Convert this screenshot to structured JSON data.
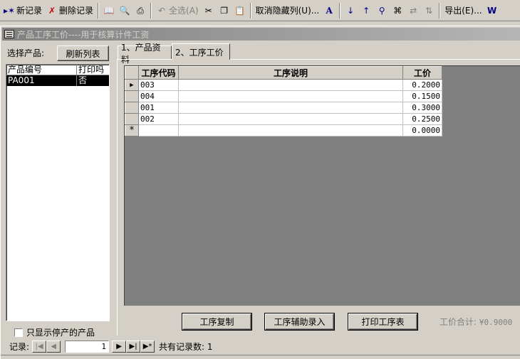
{
  "toolbar": {
    "new_record": "新记录",
    "delete_record": "删除记录",
    "undo": "全选(A)",
    "unhide_columns": "取消隐藏列(U)...",
    "export": "导出(E)..."
  },
  "window": {
    "title": "产品工序工价----用于核算计件工资"
  },
  "left": {
    "select_label": "选择产品:",
    "refresh_button": "刷新列表",
    "list_headers": [
      "产品编号",
      "打印吗"
    ],
    "list_rows": [
      {
        "code": "PA001",
        "print": "否"
      }
    ],
    "stopped_only": "只显示停产的产品"
  },
  "tabs": [
    {
      "label": "1、产品资料",
      "active": false
    },
    {
      "label": "2、工序工价",
      "active": true
    }
  ],
  "grid": {
    "headers": [
      "工序代码",
      "工序说明",
      "工价"
    ],
    "rows": [
      {
        "code": "003",
        "desc": "",
        "price": "0.2000",
        "current": true
      },
      {
        "code": "004",
        "desc": "",
        "price": "0.1500"
      },
      {
        "code": "001",
        "desc": "",
        "price": "0.3000"
      },
      {
        "code": "002",
        "desc": "",
        "price": "0.2500"
      }
    ],
    "new_row": {
      "marker": "*",
      "price": "0.0000"
    }
  },
  "buttons": {
    "copy": "工序复制",
    "assist": "工序辅助录入",
    "print": "打印工序表"
  },
  "total": {
    "label": "工价合计:",
    "value": "¥0.9000"
  },
  "recnav": {
    "label": "记录:",
    "current": "1",
    "count_text": "共有记录数: 1"
  }
}
